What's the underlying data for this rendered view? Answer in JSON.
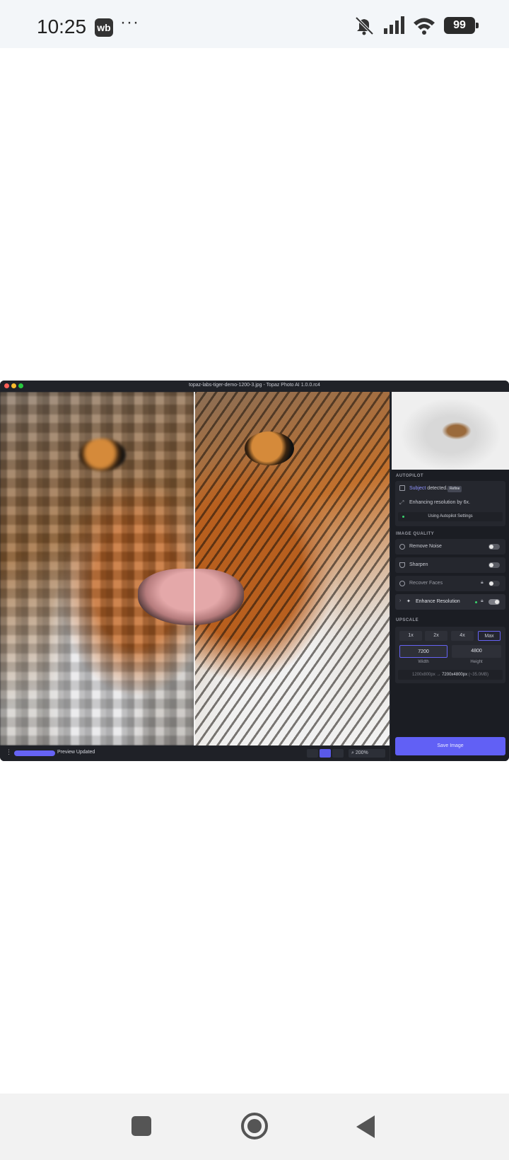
{
  "status_bar": {
    "time": "10:25",
    "app_badge": "wb",
    "more": "···",
    "battery": "99",
    "icons": [
      "bell-off-icon",
      "signal-icon",
      "wifi-icon",
      "battery-icon"
    ]
  },
  "window": {
    "title": "topaz-labs-tiger-demo-1200-3.jpg - Topaz Photo AI 1.0.0.rc4"
  },
  "bottom_bar": {
    "status": "Preview Updated",
    "zoom": "200%",
    "progress": 1.0
  },
  "sidebar": {
    "autopilot": {
      "heading": "AUTOPILOT",
      "subject_link": "Subject",
      "subject_text": " detected.",
      "refine_label": "Refine",
      "enhance_text": "Enhancing resolution by 6x.",
      "settings_label": "Using Autopilot Settings"
    },
    "image_quality": {
      "heading": "IMAGE QUALITY",
      "items": [
        {
          "label": "Remove Noise",
          "on": false
        },
        {
          "label": "Sharpen",
          "on": false
        },
        {
          "label": "Recover Faces",
          "on": false
        },
        {
          "label": "Enhance Resolution",
          "on": true
        }
      ]
    },
    "upscale": {
      "heading": "UPSCALE",
      "scales": [
        "1x",
        "2x",
        "4x",
        "Max"
      ],
      "selected_scale": "Max",
      "width_value": "7200",
      "height_value": "4800",
      "width_label": "Width",
      "height_label": "Height",
      "summary_from": "1200x800px → ",
      "summary_to": "7200x4800px",
      "summary_size": " (~35.0MB)"
    },
    "save_label": "Save Image"
  },
  "colors": {
    "accent": "#6160f5",
    "panel": "#1b1d23",
    "card": "#25272e"
  }
}
